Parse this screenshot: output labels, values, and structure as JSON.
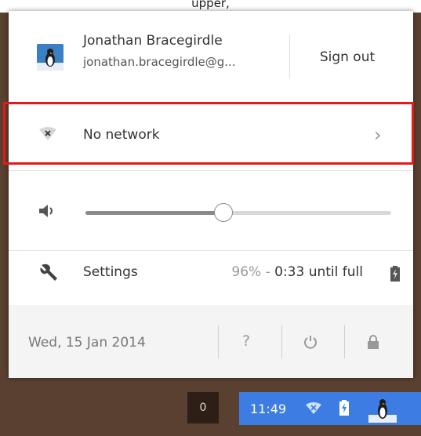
{
  "user": {
    "name": "Jonathan Bracegirdle",
    "email": "jonathan.bracegirdle@g...",
    "sign_out_label": "Sign out"
  },
  "network": {
    "label": "No network"
  },
  "volume": {
    "level": 0.45
  },
  "settings": {
    "label": "Settings",
    "battery_percent": "96%",
    "battery_separator": " - ",
    "battery_time": "0:33 until full"
  },
  "bottom": {
    "date": "Wed, 15 Jan 2014",
    "help_label": "?"
  },
  "shelf": {
    "notification_count": "0",
    "time": "11:49"
  },
  "icons": {
    "network": "wifi-x-icon",
    "volume": "speaker-icon",
    "settings": "wrench-icon",
    "battery": "battery-charging-icon",
    "help": "help-icon",
    "power": "power-icon",
    "lock": "lock-icon"
  },
  "colors": {
    "highlight": "#e3191b",
    "tray": "#3d7de3"
  }
}
